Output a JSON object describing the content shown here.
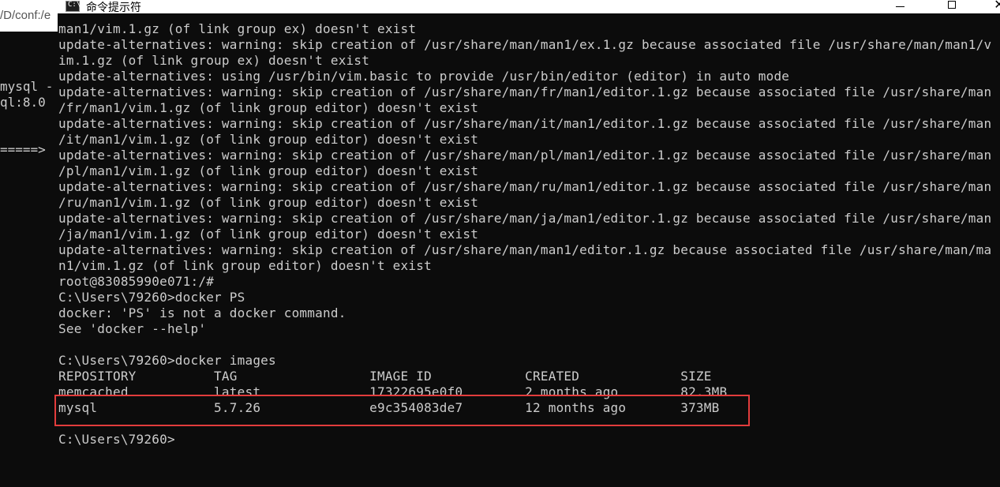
{
  "background_window": {
    "title_fragment": "/D/conf:/e",
    "lines": [
      "mysql -",
      "ql:8.0",
      "",
      "=====>"
    ]
  },
  "window": {
    "title": "命令提示符",
    "icon_label": "C:\\",
    "controls": {
      "minimize": "minimize",
      "maximize": "maximize",
      "close": "close"
    }
  },
  "console": {
    "lines": [
      "man1/vim.1.gz (of link group ex) doesn't exist",
      "update-alternatives: warning: skip creation of /usr/share/man/man1/ex.1.gz because associated file /usr/share/man/man1/v",
      "im.1.gz (of link group ex) doesn't exist",
      "update-alternatives: using /usr/bin/vim.basic to provide /usr/bin/editor (editor) in auto mode",
      "update-alternatives: warning: skip creation of /usr/share/man/fr/man1/editor.1.gz because associated file /usr/share/man",
      "/fr/man1/vim.1.gz (of link group editor) doesn't exist",
      "update-alternatives: warning: skip creation of /usr/share/man/it/man1/editor.1.gz because associated file /usr/share/man",
      "/it/man1/vim.1.gz (of link group editor) doesn't exist",
      "update-alternatives: warning: skip creation of /usr/share/man/pl/man1/editor.1.gz because associated file /usr/share/man",
      "/pl/man1/vim.1.gz (of link group editor) doesn't exist",
      "update-alternatives: warning: skip creation of /usr/share/man/ru/man1/editor.1.gz because associated file /usr/share/man",
      "/ru/man1/vim.1.gz (of link group editor) doesn't exist",
      "update-alternatives: warning: skip creation of /usr/share/man/ja/man1/editor.1.gz because associated file /usr/share/man",
      "/ja/man1/vim.1.gz (of link group editor) doesn't exist",
      "update-alternatives: warning: skip creation of /usr/share/man/man1/editor.1.gz because associated file /usr/share/man/ma",
      "n1/vim.1.gz (of link group editor) doesn't exist",
      "root@83085990e071:/#",
      "C:\\Users\\79260>docker PS",
      "docker: 'PS' is not a docker command.",
      "See 'docker --help'",
      "",
      "C:\\Users\\79260>docker images",
      "REPOSITORY          TAG                 IMAGE ID            CREATED             SIZE",
      "memcached           latest              17322695e0f0        2 months ago        82.3MB",
      "mysql               5.7.26              e9c354083de7        12 months ago       373MB",
      "",
      "C:\\Users\\79260>"
    ]
  },
  "colors": {
    "console_bg": "#0c0c0c",
    "console_fg": "#cccccc",
    "highlight": "#e23c3c"
  }
}
